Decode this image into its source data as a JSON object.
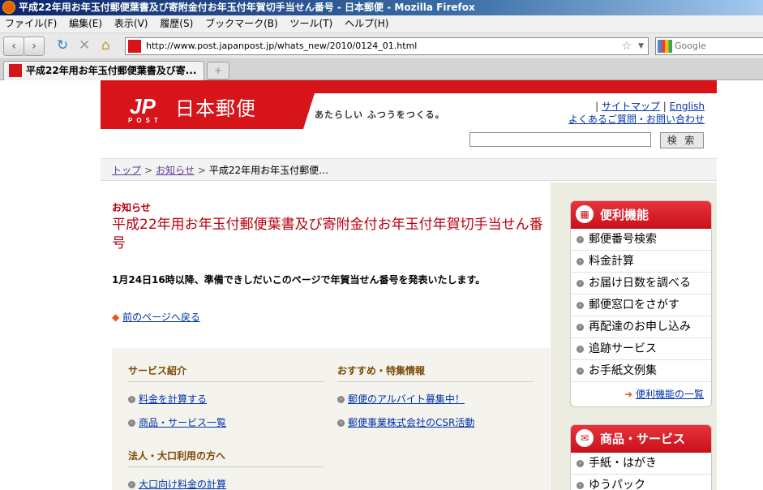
{
  "window": {
    "title": "平成22年用お年玉付郵便葉書及び寄附金付お年玉付年賀切手当せん番号 - 日本郵便 - Mozilla Firefox"
  },
  "menu": [
    "ファイル(F)",
    "編集(E)",
    "表示(V)",
    "履歴(S)",
    "ブックマーク(B)",
    "ツール(T)",
    "ヘルプ(H)"
  ],
  "navbar": {
    "url": "http://www.post.japanpost.jp/whats_new/2010/0124_01.html",
    "search_placeholder": "Google"
  },
  "tab": {
    "label": "平成22年用お年玉付郵便葉書及び寄..."
  },
  "header": {
    "logo_mark": "JP",
    "logo_sub": "POST",
    "logo_name": "日本郵便",
    "tagline": "あたらしい ふつうをつくる。",
    "link_sitemap": "サイトマップ",
    "link_english": "English",
    "link_faq": "よくあるご質問・お問い合わせ",
    "search_button": "検 索"
  },
  "breadcrumb": {
    "top": "トップ",
    "news": "お知らせ",
    "current": "平成22年用お年玉付郵便…"
  },
  "main": {
    "kicker": "お知らせ",
    "title": "平成22年用お年玉付郵便葉書及び寄附金付お年玉付年賀切手当せん番号",
    "body": "1月24日16時以降、準備できしだいこのページで年賀当せん番号を発表いたします。",
    "back_link": "前のページへ戻る"
  },
  "services": {
    "col1_heading": "サービス紹介",
    "col1_links": [
      "料金を計算する",
      "商品・サービス一覧"
    ],
    "col1b_heading": "法人・大口利用の方へ",
    "col1b_links": [
      "大口向け料金の計算"
    ],
    "col2_heading": "おすすめ・特集情報",
    "col2_links": [
      "郵便のアルバイト募集中！",
      "郵便事業株式会社のCSR活動"
    ]
  },
  "sidebar": {
    "convenience_title": "便利機能",
    "convenience_items": [
      "郵便番号検索",
      "料金計算",
      "お届け日数を調べる",
      "郵便窓口をさがす",
      "再配達のお申し込み",
      "追跡サービス",
      "お手紙文例集"
    ],
    "convenience_more": "便利機能の一覧",
    "products_title": "商品・サービス",
    "products_items": [
      "手紙・はがき",
      "ゆうパック"
    ]
  }
}
